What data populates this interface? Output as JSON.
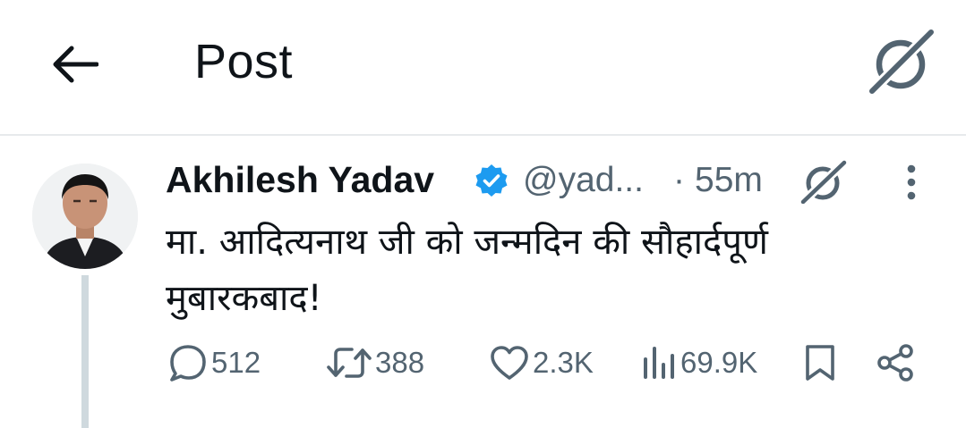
{
  "header": {
    "title": "Post"
  },
  "post": {
    "author_name": "Akhilesh Yadav",
    "handle": "@yad...",
    "separator": "·",
    "time": "55m",
    "text": "मा. आदित्यनाथ जी को जन्मदिन की सौहार्दपूर्ण मुबारकबाद!",
    "actions": {
      "replies": "512",
      "reposts": "388",
      "likes": "2.3K",
      "views": "69.9K"
    }
  },
  "colors": {
    "text": "#0f1419",
    "secondary": "#536471",
    "verified": "#1d9bf0",
    "divider": "#e7eaec",
    "thread_line": "#cfd9de"
  },
  "icons": [
    "back-arrow-icon",
    "grok-icon",
    "verified-badge-icon",
    "more-vertical-icon",
    "reply-icon",
    "repost-icon",
    "like-icon",
    "views-icon",
    "bookmark-icon",
    "share-icon"
  ]
}
